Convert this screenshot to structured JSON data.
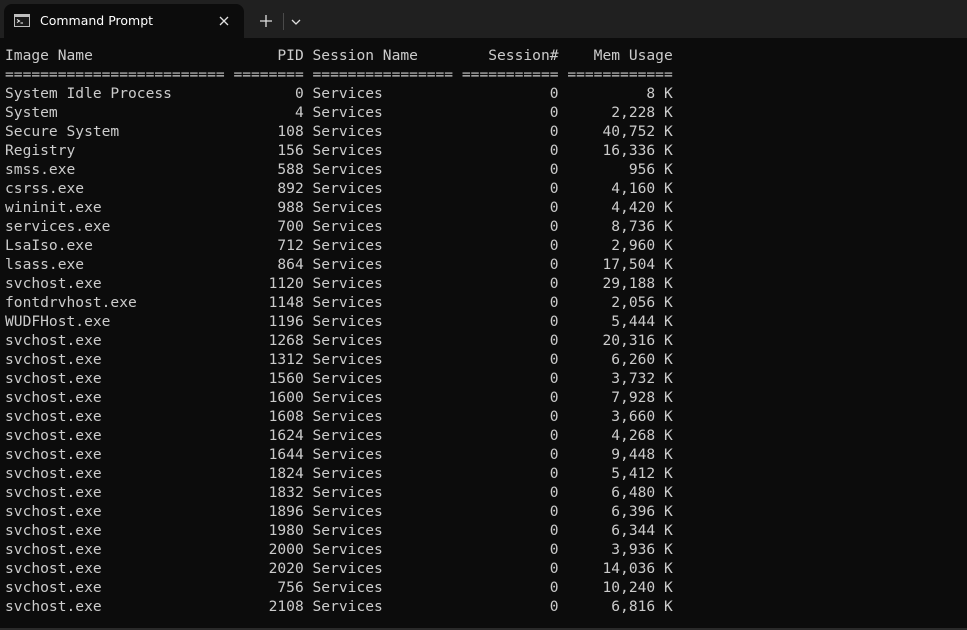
{
  "window": {
    "tab_title": "Command Prompt",
    "tab_icon": "terminal-icon",
    "close_icon": "close-icon",
    "new_tab_icon": "plus-icon",
    "dropdown_icon": "chevron-down-icon"
  },
  "colors": {
    "titlebar_bg": "#202020",
    "terminal_bg": "#0c0c0c",
    "terminal_fg": "#cccccc"
  },
  "terminal": {
    "header": "Image Name                     PID Session Name        Session#    Mem Usage",
    "separator": "========================= ======== ================ =========== ============",
    "rows": [
      {
        "name": "System Idle Process",
        "pid": "0",
        "session_name": "Services",
        "session": "0",
        "mem": "8 K"
      },
      {
        "name": "System",
        "pid": "4",
        "session_name": "Services",
        "session": "0",
        "mem": "2,228 K"
      },
      {
        "name": "Secure System",
        "pid": "108",
        "session_name": "Services",
        "session": "0",
        "mem": "40,752 K"
      },
      {
        "name": "Registry",
        "pid": "156",
        "session_name": "Services",
        "session": "0",
        "mem": "16,336 K"
      },
      {
        "name": "smss.exe",
        "pid": "588",
        "session_name": "Services",
        "session": "0",
        "mem": "956 K"
      },
      {
        "name": "csrss.exe",
        "pid": "892",
        "session_name": "Services",
        "session": "0",
        "mem": "4,160 K"
      },
      {
        "name": "wininit.exe",
        "pid": "988",
        "session_name": "Services",
        "session": "0",
        "mem": "4,420 K"
      },
      {
        "name": "services.exe",
        "pid": "700",
        "session_name": "Services",
        "session": "0",
        "mem": "8,736 K"
      },
      {
        "name": "LsaIso.exe",
        "pid": "712",
        "session_name": "Services",
        "session": "0",
        "mem": "2,960 K"
      },
      {
        "name": "lsass.exe",
        "pid": "864",
        "session_name": "Services",
        "session": "0",
        "mem": "17,504 K"
      },
      {
        "name": "svchost.exe",
        "pid": "1120",
        "session_name": "Services",
        "session": "0",
        "mem": "29,188 K"
      },
      {
        "name": "fontdrvhost.exe",
        "pid": "1148",
        "session_name": "Services",
        "session": "0",
        "mem": "2,056 K"
      },
      {
        "name": "WUDFHost.exe",
        "pid": "1196",
        "session_name": "Services",
        "session": "0",
        "mem": "5,444 K"
      },
      {
        "name": "svchost.exe",
        "pid": "1268",
        "session_name": "Services",
        "session": "0",
        "mem": "20,316 K"
      },
      {
        "name": "svchost.exe",
        "pid": "1312",
        "session_name": "Services",
        "session": "0",
        "mem": "6,260 K"
      },
      {
        "name": "svchost.exe",
        "pid": "1560",
        "session_name": "Services",
        "session": "0",
        "mem": "3,732 K"
      },
      {
        "name": "svchost.exe",
        "pid": "1600",
        "session_name": "Services",
        "session": "0",
        "mem": "7,928 K"
      },
      {
        "name": "svchost.exe",
        "pid": "1608",
        "session_name": "Services",
        "session": "0",
        "mem": "3,660 K"
      },
      {
        "name": "svchost.exe",
        "pid": "1624",
        "session_name": "Services",
        "session": "0",
        "mem": "4,268 K"
      },
      {
        "name": "svchost.exe",
        "pid": "1644",
        "session_name": "Services",
        "session": "0",
        "mem": "9,448 K"
      },
      {
        "name": "svchost.exe",
        "pid": "1824",
        "session_name": "Services",
        "session": "0",
        "mem": "5,412 K"
      },
      {
        "name": "svchost.exe",
        "pid": "1832",
        "session_name": "Services",
        "session": "0",
        "mem": "6,480 K"
      },
      {
        "name": "svchost.exe",
        "pid": "1896",
        "session_name": "Services",
        "session": "0",
        "mem": "6,396 K"
      },
      {
        "name": "svchost.exe",
        "pid": "1980",
        "session_name": "Services",
        "session": "0",
        "mem": "6,344 K"
      },
      {
        "name": "svchost.exe",
        "pid": "2000",
        "session_name": "Services",
        "session": "0",
        "mem": "3,936 K"
      },
      {
        "name": "svchost.exe",
        "pid": "2020",
        "session_name": "Services",
        "session": "0",
        "mem": "14,036 K"
      },
      {
        "name": "svchost.exe",
        "pid": "756",
        "session_name": "Services",
        "session": "0",
        "mem": "10,240 K"
      },
      {
        "name": "svchost.exe",
        "pid": "2108",
        "session_name": "Services",
        "session": "0",
        "mem": "6,816 K"
      }
    ]
  }
}
